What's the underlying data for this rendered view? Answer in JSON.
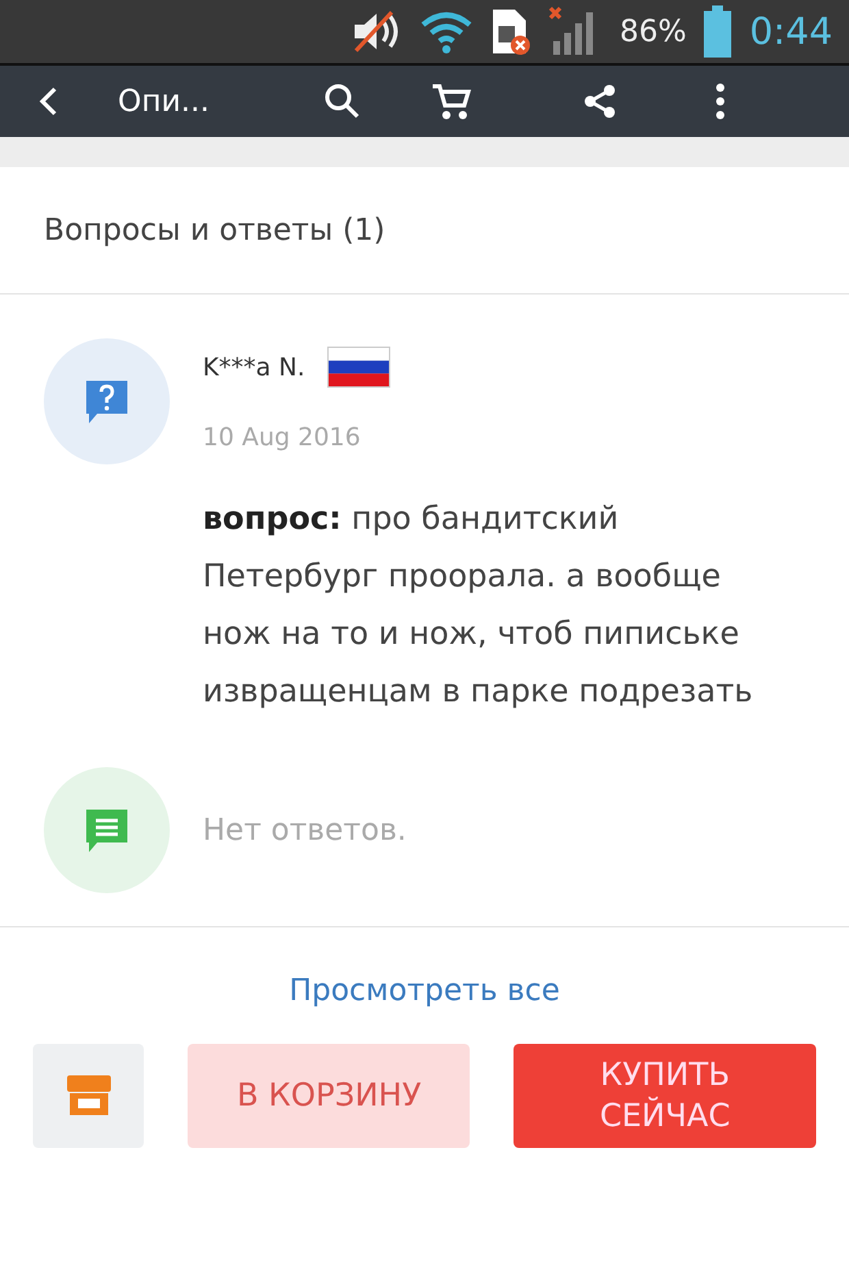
{
  "status_bar": {
    "battery": "86%",
    "time": "0:44"
  },
  "toolbar": {
    "title": "Опи..."
  },
  "qa": {
    "title": "Вопросы и ответы (1)",
    "question": {
      "author": "K***a N.",
      "date": "10 Aug 2016",
      "label": "вопрос:",
      "text": "про бандитский Петербург проорала. а вообще нож на то и нож, чтоб пипиське извращенцам в парке подрезать"
    },
    "answer": {
      "text": "Нет ответов."
    },
    "view_all": "Просмотреть все"
  },
  "actions": {
    "add_to_cart": "В КОРЗИНУ",
    "buy_now": "КУПИТЬ СЕЙЧАС"
  }
}
